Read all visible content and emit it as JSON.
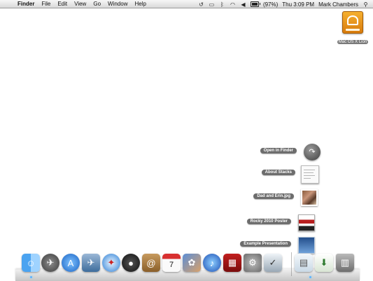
{
  "menubar": {
    "apple_icon": "apple-icon",
    "items": [
      {
        "label": "Finder",
        "bold": true
      },
      {
        "label": "File"
      },
      {
        "label": "Edit"
      },
      {
        "label": "View"
      },
      {
        "label": "Go"
      },
      {
        "label": "Window"
      },
      {
        "label": "Help"
      }
    ],
    "status": {
      "battery_text": "(97%)",
      "battery_level": 0.97,
      "clock": "Thu 3:09 PM",
      "user": "Mark Chambers"
    }
  },
  "desktop": {
    "drive_label": "Mac OS X Lion"
  },
  "stack": {
    "items": [
      {
        "label": "Open in Finder"
      },
      {
        "label": "About Stacks"
      },
      {
        "label": "Dad and Erin.jpg"
      },
      {
        "label": "Rocky 2010 Poster"
      },
      {
        "label": "Example Presentation"
      }
    ]
  },
  "dock": {
    "apps": [
      {
        "icon": "finder-icon",
        "running": true
      },
      {
        "icon": "launchpad-icon"
      },
      {
        "icon": "app-store-icon"
      },
      {
        "icon": "preview-icon"
      },
      {
        "icon": "safari-icon"
      },
      {
        "icon": "facetime-icon"
      },
      {
        "icon": "address-book-icon"
      },
      {
        "icon": "ical-icon",
        "day": "7"
      },
      {
        "icon": "iphoto-icon"
      },
      {
        "icon": "itunes-icon"
      },
      {
        "icon": "photo-booth-icon"
      },
      {
        "icon": "system-preferences-icon"
      },
      {
        "icon": "preview-app-icon"
      },
      {
        "icon": "documents-stack-icon"
      },
      {
        "icon": "downloads-stack-icon"
      },
      {
        "icon": "trash-icon"
      }
    ],
    "colors": {
      "indicator": "#5db3ff"
    }
  }
}
